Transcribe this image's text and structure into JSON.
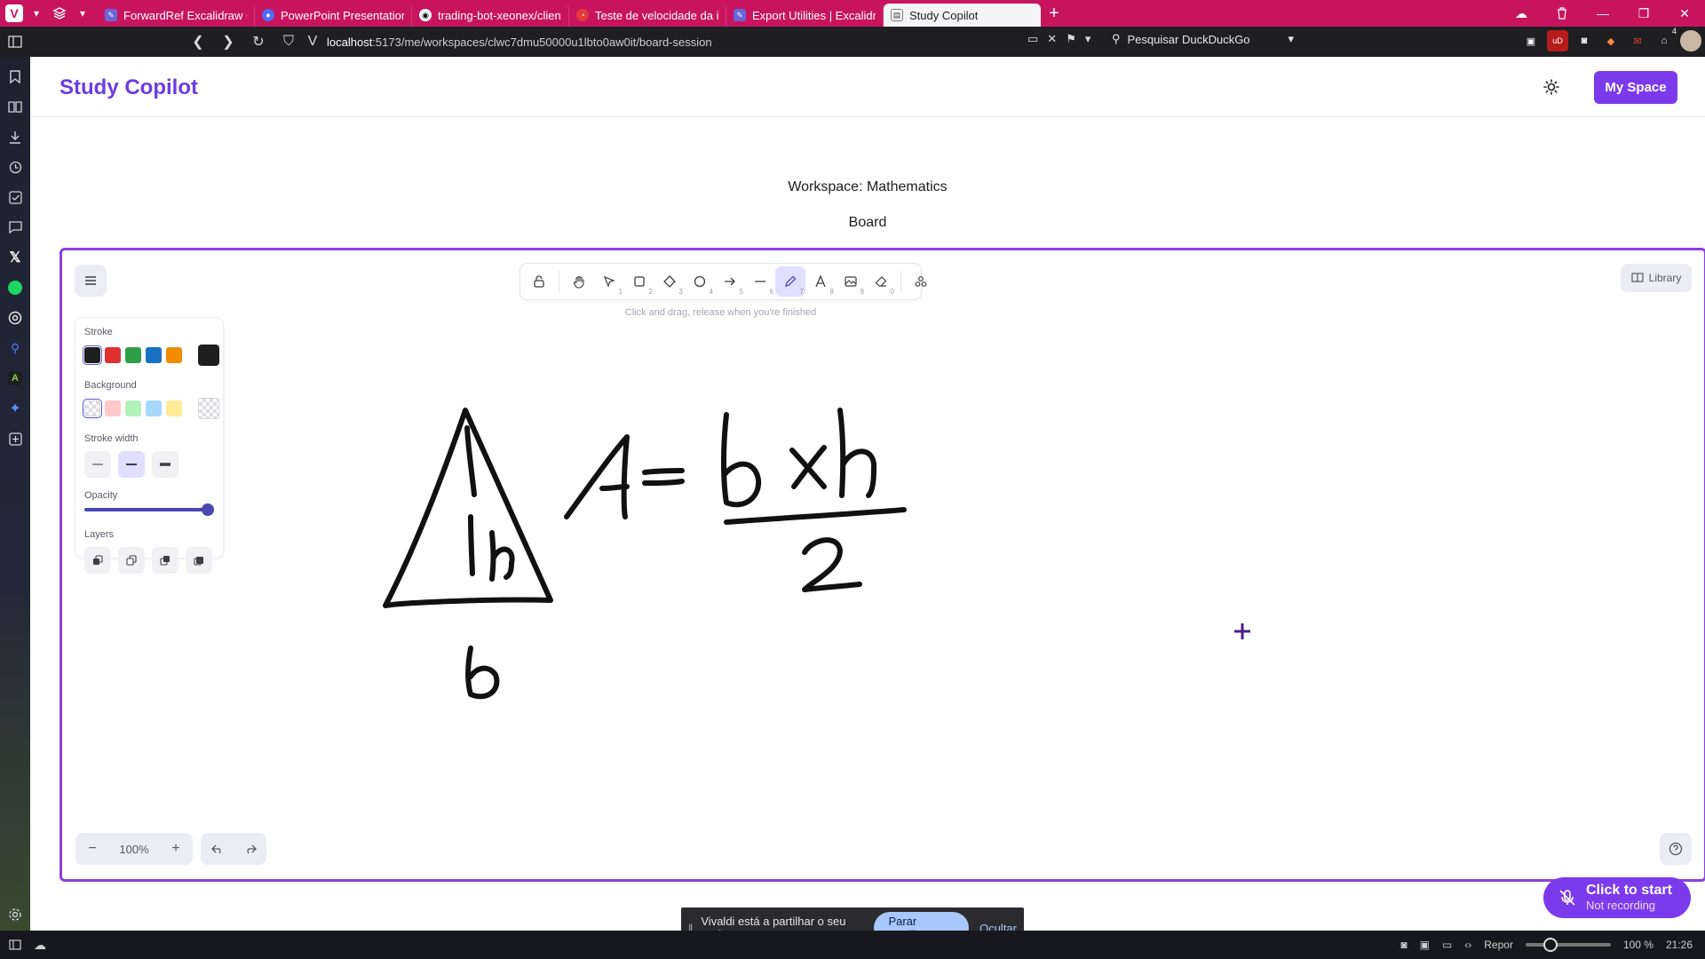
{
  "browser": {
    "tabs": [
      {
        "title": "ForwardRef Excalidraw Com",
        "active": false
      },
      {
        "title": "PowerPoint Presentation",
        "active": false
      },
      {
        "title": "trading-bot-xeonex/client/s",
        "active": false
      },
      {
        "title": "Teste de velocidade da inte",
        "active": false
      },
      {
        "title": "Export Utilities | Excalidraw",
        "active": false
      },
      {
        "title": "Study Copilot",
        "active": true
      }
    ],
    "url_host": "localhost",
    "url_path": ":5173/me/workspaces/clwc7dmu50000u1lbto0aw0it/board-session",
    "search_placeholder": "Pesquisar DuckDuckGo",
    "notification_count": "4",
    "accent_color": "#c8145f"
  },
  "statusbar": {
    "reset_label": "Repor",
    "zoom_percent": "100 %",
    "clock": "21:26",
    "zoom_level": 1.0
  },
  "app": {
    "brand": "Study Copilot",
    "my_space_label": "My Space",
    "workspace_title": "Workspace: Mathematics",
    "board_title": "Board",
    "accent_color": "#7c3aed"
  },
  "excalidraw": {
    "hint": "Click and drag, release when you're finished",
    "library_label": "Library",
    "tools": [
      {
        "name": "lock",
        "key": ""
      },
      {
        "name": "hand",
        "key": ""
      },
      {
        "name": "selection",
        "key": "1"
      },
      {
        "name": "rectangle",
        "key": "2"
      },
      {
        "name": "diamond",
        "key": "3"
      },
      {
        "name": "ellipse",
        "key": "4"
      },
      {
        "name": "arrow",
        "key": "5"
      },
      {
        "name": "line",
        "key": "6"
      },
      {
        "name": "freedraw",
        "key": "7",
        "active": true
      },
      {
        "name": "text",
        "key": "8"
      },
      {
        "name": "image",
        "key": "9"
      },
      {
        "name": "eraser",
        "key": "0"
      },
      {
        "name": "extra-tools",
        "key": ""
      }
    ],
    "properties": {
      "stroke_label": "Stroke",
      "stroke_colors": [
        "#1e1e1e",
        "#e03131",
        "#2f9e44",
        "#1971c2",
        "#f08c00"
      ],
      "stroke_current": "#1e1e1e",
      "background_label": "Background",
      "background_colors": [
        "transparent",
        "#ffc9c9",
        "#b2f2bb",
        "#a5d8ff",
        "#ffec99"
      ],
      "background_current": "transparent",
      "stroke_width_label": "Stroke width",
      "stroke_width_selected": "bold",
      "opacity_label": "Opacity",
      "opacity_value": 100,
      "layers_label": "Layers"
    },
    "zoom_label": "100%"
  },
  "recording": {
    "title": "Click to start",
    "status": "Not recording"
  },
  "share_bar": {
    "message": "Vivaldi está a partilhar o seu ecrã.",
    "stop_label": "Parar partilha",
    "hide_label": "Ocultar"
  }
}
